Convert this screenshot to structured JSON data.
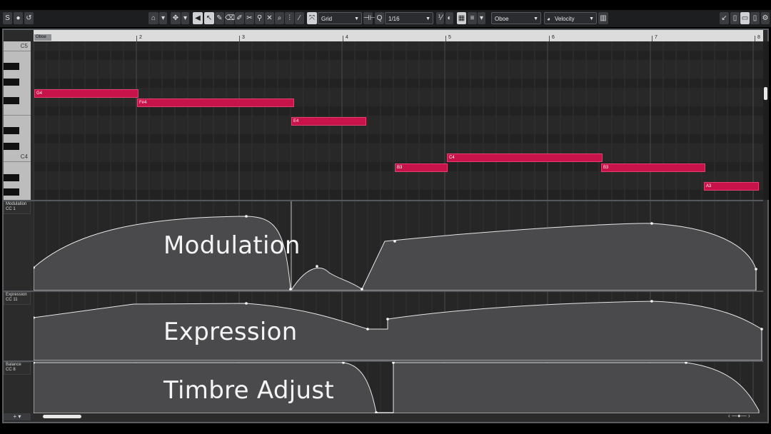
{
  "toolbar": {
    "snap_label": "Grid",
    "quantize_value": "1/16",
    "instrument": "Oboe",
    "lane_param": "Velocity"
  },
  "ruler": {
    "part_name": "Oboe",
    "bars": [
      "2",
      "3",
      "4",
      "5",
      "6",
      "7",
      "8"
    ]
  },
  "keyboard": {
    "labels": [
      "C5",
      "C4"
    ]
  },
  "notes": [
    {
      "pitch": "G4"
    },
    {
      "pitch": "F#4"
    },
    {
      "pitch": "E4"
    },
    {
      "pitch": "B3"
    },
    {
      "pitch": "C4"
    },
    {
      "pitch": "B3"
    },
    {
      "pitch": "A3"
    }
  ],
  "lanes": [
    {
      "name": "Modulation",
      "cc": "CC 1",
      "title": "Modulation"
    },
    {
      "name": "Expression",
      "cc": "CC 11",
      "title": "Expression"
    },
    {
      "name": "Balance",
      "cc": "CC 8",
      "title": "Timbre Adjust"
    }
  ],
  "colors": {
    "note_fill": "#c8124a",
    "lane_bg": "#262626",
    "curve_fill": "#4a4a4c"
  }
}
